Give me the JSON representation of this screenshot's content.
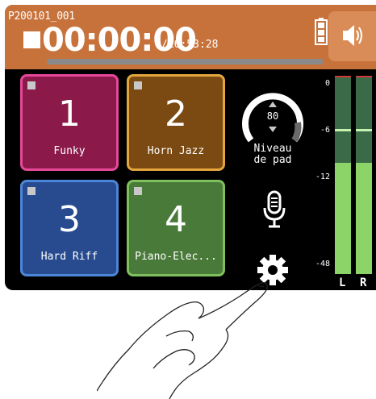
{
  "header": {
    "project_name": "P200101_001",
    "elapsed_time": "00:00:00",
    "remaining_time": "/16:53:28",
    "progress_fraction": 0.0
  },
  "pads": [
    {
      "number": "1",
      "name": "Funky",
      "color": "#8b1a4b",
      "border": "#e8489a"
    },
    {
      "number": "2",
      "name": "Horn Jazz",
      "color": "#7a4a12",
      "border": "#e3a63f"
    },
    {
      "number": "3",
      "name": "Hard Riff",
      "color": "#274b8e",
      "border": "#4b86d9"
    },
    {
      "number": "4",
      "name": "Piano-Elec...",
      "color": "#4a7a3a",
      "border": "#7fc05e"
    }
  ],
  "pad_level": {
    "value": "80",
    "label_line1": "Niveau",
    "label_line2": "de pad"
  },
  "meters": {
    "scale": [
      "0",
      "-6",
      "-12",
      "-48"
    ],
    "left_label": "L",
    "right_label": "R",
    "left_level_fraction": 0.56,
    "right_level_fraction": 0.56
  },
  "icons": {
    "battery": "battery-icon",
    "speaker": "speaker-icon",
    "stop": "stop-icon",
    "microphone": "microphone-icon",
    "settings": "gear-icon"
  },
  "colors": {
    "header_bar": "#c7723b",
    "meter_green": "#8cd368"
  }
}
